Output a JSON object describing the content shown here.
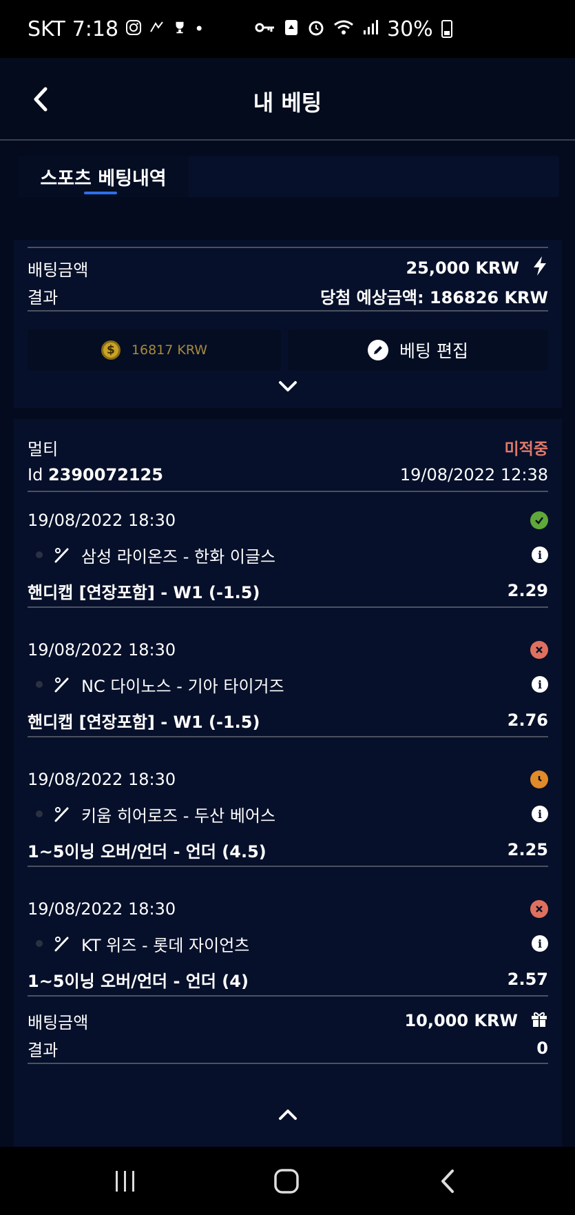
{
  "status_bar": {
    "carrier": "SKT",
    "time": "7:18",
    "battery": "30%"
  },
  "header": {
    "title": "내 베팅"
  },
  "tabs": [
    {
      "label": "스포츠 베팅내역"
    }
  ],
  "summary": {
    "stake_label": "배팅금액",
    "stake_value": "25,000 KRW",
    "result_label": "결과",
    "expected_text": "당첨 예상금액: 186826 KRW",
    "balance_value": "16817",
    "balance_currency": "KRW",
    "edit_label": "베팅 편집"
  },
  "bet": {
    "type": "멀티",
    "status": "미적중",
    "id_label": "Id",
    "id_value": "2390072125",
    "date": "19/08/2022 12:38",
    "selections": [
      {
        "datetime": "19/08/2022 18:30",
        "match": "삼성 라이온즈 - 한화 이글스",
        "market": "핸디캡 [연장포함] - W1 (-1.5)",
        "odds": "2.29",
        "state": "win"
      },
      {
        "datetime": "19/08/2022 18:30",
        "match": "NC 다이노스 - 기아 타이거즈",
        "market": "핸디캡 [연장포함] - W1 (-1.5)",
        "odds": "2.76",
        "state": "lose"
      },
      {
        "datetime": "19/08/2022 18:30",
        "match": "키움 히어로즈 - 두산 베어스",
        "market": "1~5이닝 오버/언더 - 언더 (4.5)",
        "odds": "2.25",
        "state": "pending"
      },
      {
        "datetime": "19/08/2022 18:30",
        "match": "KT 위즈 - 롯데 자이언츠",
        "market": "1~5이닝 오버/언더 - 언더 (4)",
        "odds": "2.57",
        "state": "lose"
      }
    ],
    "stake_label": "배팅금액",
    "stake_value": "10,000 KRW",
    "result_label": "결과",
    "result_value": "0"
  },
  "colors": {
    "background": "#040b1f",
    "card": "#07102a",
    "lose": "#e0705e",
    "win": "#5fa83a",
    "pending": "#e08a2a",
    "accent": "#2f6fe8"
  }
}
